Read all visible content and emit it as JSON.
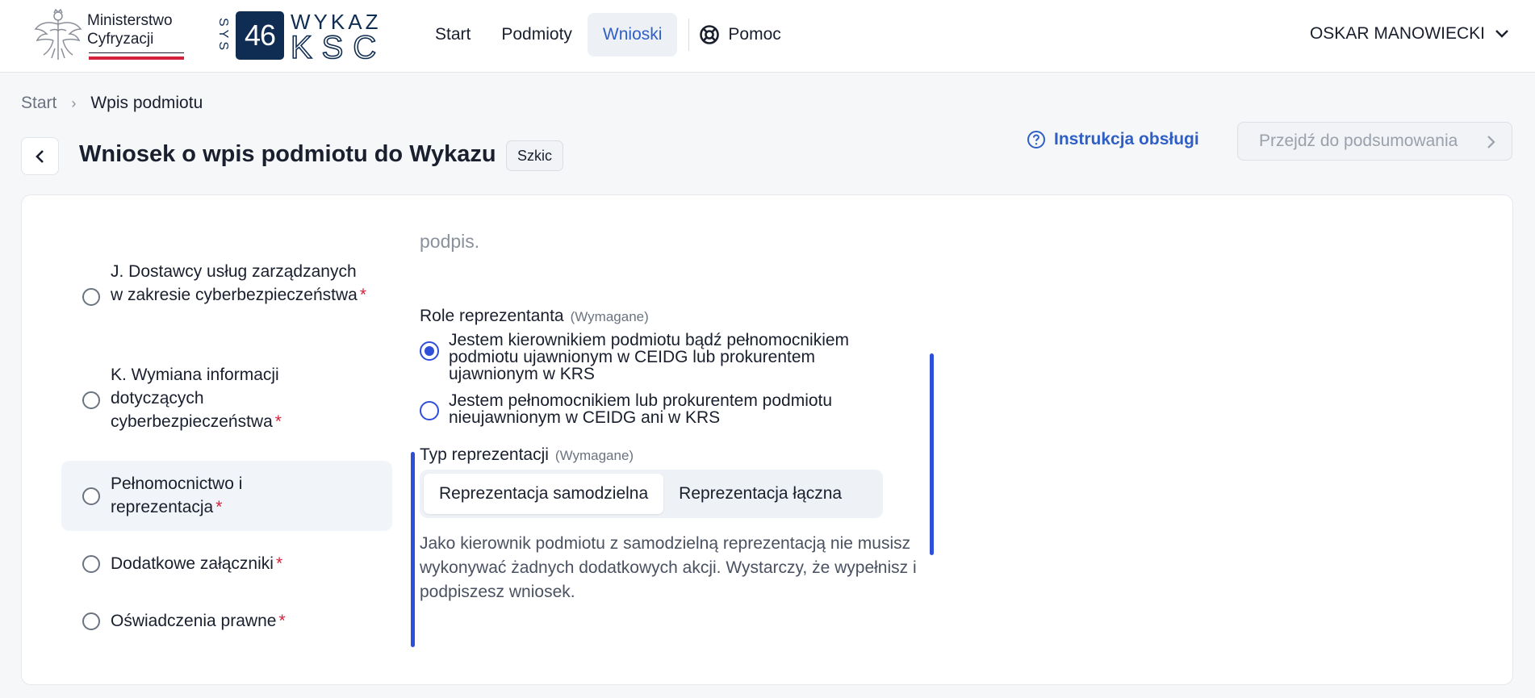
{
  "header": {
    "ministry_name": "Ministerstwo Cyfryzacji",
    "logo_number": "46",
    "logo_side_text": "SYS",
    "logo_text_top": "WYKAZ",
    "logo_text_bottom": "KSC",
    "nav": [
      {
        "label": "Start",
        "active": false
      },
      {
        "label": "Podmioty",
        "active": false
      },
      {
        "label": "Wnioski",
        "active": true
      }
    ],
    "help": {
      "label": "Pomoc",
      "icon": "lifebuoy-icon"
    },
    "user": {
      "name": "OSKAR MANOWIECKI",
      "icon": "chevron-down-icon"
    }
  },
  "breadcrumb": {
    "start": "Start",
    "separator": "›",
    "current": "Wpis podmiotu"
  },
  "page": {
    "title": "Wniosek o wpis podmiotu do Wykazu",
    "badge": "Szkic",
    "instructions_link": "Instrukcja obsługi",
    "summary_button": "Przejdź do podsumowania"
  },
  "steps": [
    {
      "label": "J. Dostawcy usług zarządzanych w zakresie cyberbezpieczeństwa",
      "required": "*",
      "active": false
    },
    {
      "label": "K. Wymiana informacji dotyczących cyberbezpieczeństwa",
      "required": "*",
      "active": false
    },
    {
      "label": "Pełnomocnictwo i reprezentacja",
      "required": "*",
      "active": true
    },
    {
      "label": "Dodatkowe załączniki",
      "required": "*",
      "active": false
    },
    {
      "label": "Oświadczenia prawne",
      "required": "*",
      "active": false
    }
  ],
  "form": {
    "faded_text": "podpis.",
    "roles": {
      "label": "Role reprezentanta",
      "required_tag": "(Wymagane)",
      "options": [
        {
          "label": "Jestem kierownikiem podmiotu bądź pełnomocnikiem podmiotu ujawnionym w CEIDG lub prokurentem ujawnionym w KRS",
          "checked": true
        },
        {
          "label": "Jestem pełnomocnikiem lub prokurentem podmiotu nieujawnionym w CEIDG ani w KRS",
          "checked": false
        }
      ]
    },
    "representation": {
      "label": "Typ reprezentacji",
      "required_tag": "(Wymagane)",
      "options": [
        {
          "label": "Reprezentacja samodzielna",
          "selected": true
        },
        {
          "label": "Reprezentacja łączna",
          "selected": false
        }
      ]
    },
    "info": "Jako kierownik podmiotu z samodzielną reprezentacją nie musisz wykonywać żadnych dodatkowych akcji. Wystarczy, że wypełnisz i podpiszesz wniosek."
  },
  "colors": {
    "accent": "#2f4fd9",
    "link": "#2f5fc4",
    "required": "#d4213d",
    "logo_navy": "#0f2d52"
  }
}
